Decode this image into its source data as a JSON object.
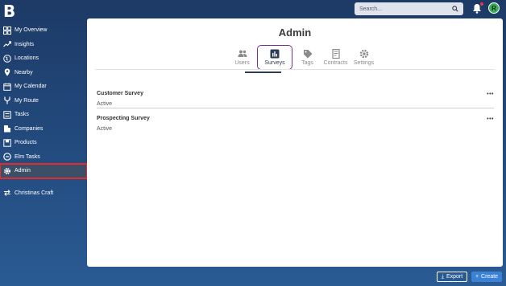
{
  "header": {
    "logo": "B",
    "search_placeholder": "Search...",
    "avatar_initial": "R"
  },
  "sidebar": {
    "items": [
      {
        "label": "My Overview",
        "icon": "grid-icon"
      },
      {
        "label": "Insights",
        "icon": "trend-icon"
      },
      {
        "label": "Locations",
        "icon": "globe-icon"
      },
      {
        "label": "Nearby",
        "icon": "pin-icon"
      },
      {
        "label": "My Calendar",
        "icon": "calendar-icon"
      },
      {
        "label": "My Route",
        "icon": "route-icon"
      },
      {
        "label": "Tasks",
        "icon": "tasks-icon"
      },
      {
        "label": "Companies",
        "icon": "building-icon"
      },
      {
        "label": "Products",
        "icon": "box-icon"
      },
      {
        "label": "Elm Tasks",
        "icon": "elm-icon"
      },
      {
        "label": "Admin",
        "icon": "gear-icon"
      }
    ],
    "extra": {
      "label": "Christinas Craft",
      "icon": "swap-icon"
    }
  },
  "main": {
    "title": "Admin",
    "tabs": [
      {
        "label": "Users"
      },
      {
        "label": "Surveys"
      },
      {
        "label": "Tags"
      },
      {
        "label": "Contracts"
      },
      {
        "label": "Settings"
      }
    ],
    "surveys": [
      {
        "name": "Customer Survey",
        "status": "Active"
      },
      {
        "name": "Prospecting Survey",
        "status": "Active"
      }
    ],
    "more_label": "•••"
  },
  "footer": {
    "export_label": "Export",
    "create_label": "Create"
  }
}
